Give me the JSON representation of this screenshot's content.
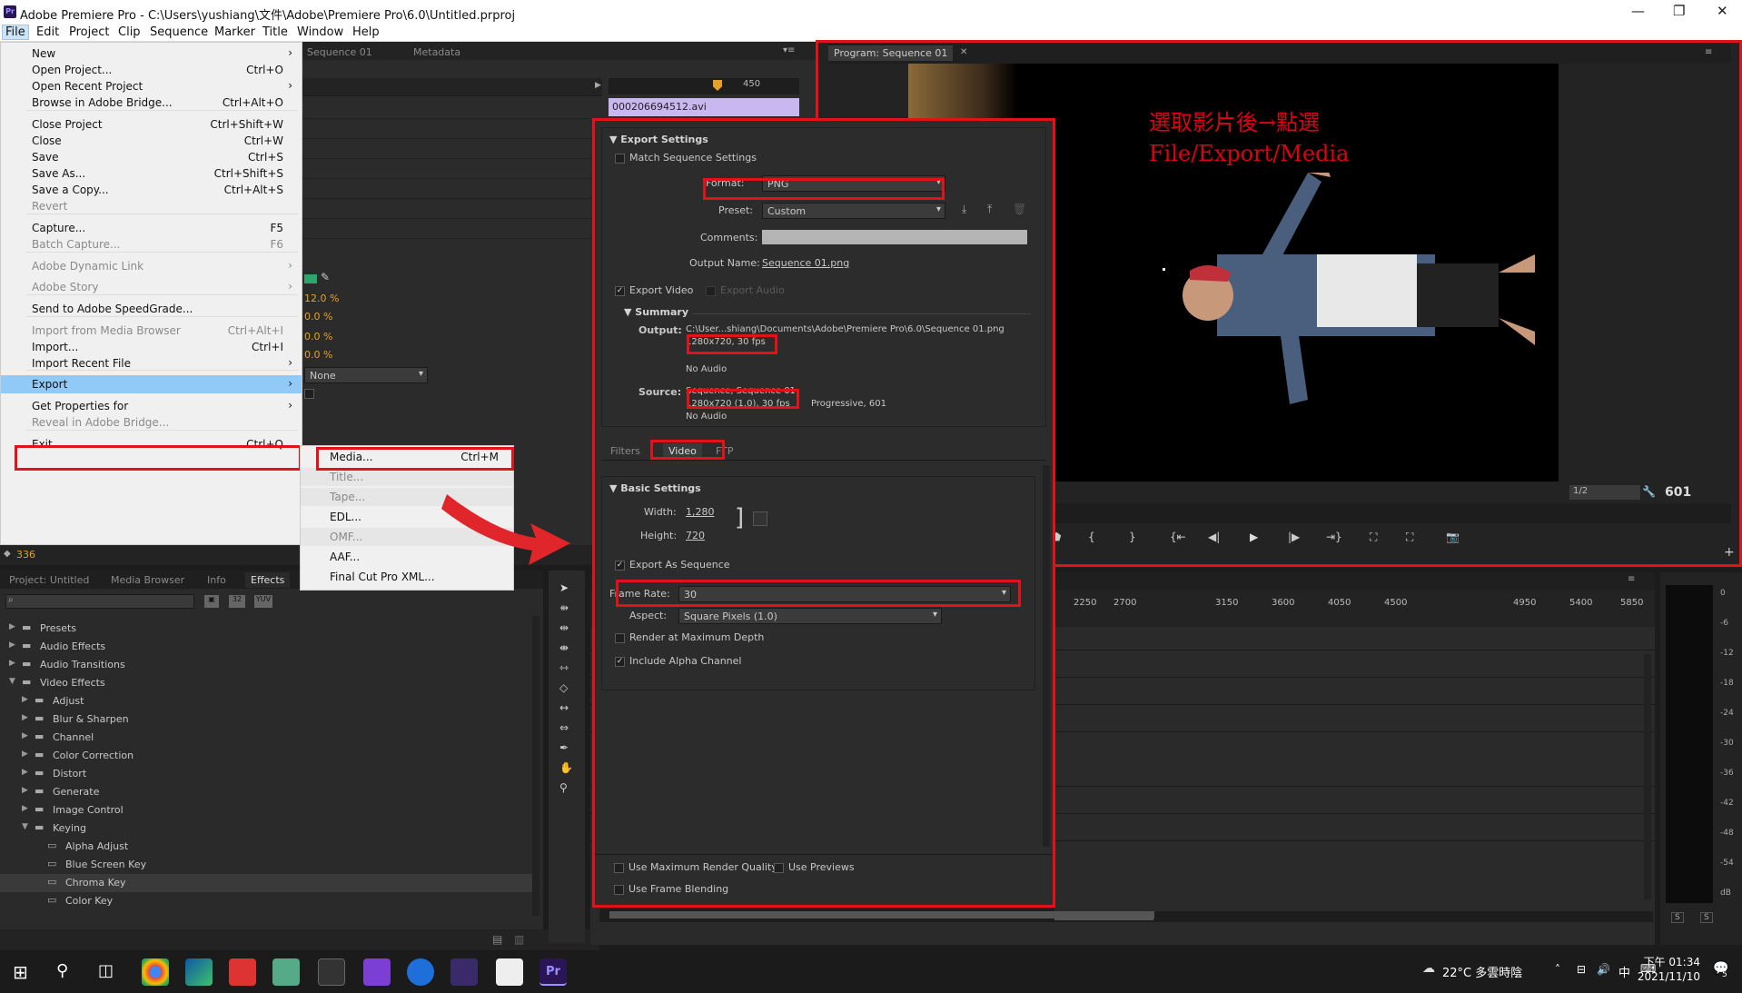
{
  "window": {
    "title": "Adobe Premiere Pro - C:\\Users\\yushiang\\文件\\Adobe\\Premiere Pro\\6.0\\Untitled.prproj",
    "app_icon": "Pr",
    "controls": [
      "—",
      "❐",
      "✕"
    ]
  },
  "menubar": [
    "File",
    "Edit",
    "Project",
    "Clip",
    "Sequence",
    "Marker",
    "Title",
    "Window",
    "Help"
  ],
  "file_menu": [
    {
      "label": "New",
      "shortcut": "",
      "arrow": true
    },
    {
      "label": "Open Project...",
      "shortcut": "Ctrl+O"
    },
    {
      "label": "Open Recent Project",
      "shortcut": "",
      "arrow": true
    },
    {
      "label": "Browse in Adobe Bridge...",
      "shortcut": "Ctrl+Alt+O"
    },
    {
      "label": "Close Project",
      "shortcut": "Ctrl+Shift+W"
    },
    {
      "label": "Close",
      "shortcut": "Ctrl+W"
    },
    {
      "label": "Save",
      "shortcut": "Ctrl+S"
    },
    {
      "label": "Save As...",
      "shortcut": "Ctrl+Shift+S"
    },
    {
      "label": "Save a Copy...",
      "shortcut": "Ctrl+Alt+S"
    },
    {
      "label": "Revert",
      "shortcut": "",
      "disabled": true
    },
    {
      "label": "Capture...",
      "shortcut": "F5"
    },
    {
      "label": "Batch Capture...",
      "shortcut": "F6",
      "disabled": true
    },
    {
      "label": "Adobe Dynamic Link",
      "shortcut": "",
      "arrow": true,
      "disabled": true
    },
    {
      "label": "Adobe Story",
      "shortcut": "",
      "arrow": true,
      "disabled": true
    },
    {
      "label": "Send to Adobe SpeedGrade...",
      "shortcut": ""
    },
    {
      "label": "Import from Media Browser",
      "shortcut": "Ctrl+Alt+I",
      "disabled": true
    },
    {
      "label": "Import...",
      "shortcut": "Ctrl+I"
    },
    {
      "label": "Import Recent File",
      "shortcut": "",
      "arrow": true
    },
    {
      "label": "Export",
      "shortcut": "",
      "arrow": true
    },
    {
      "label": "Get Properties for",
      "shortcut": "",
      "arrow": true
    },
    {
      "label": "Reveal in Adobe Bridge...",
      "shortcut": "",
      "disabled": true
    },
    {
      "label": "Exit",
      "shortcut": "Ctrl+Q"
    }
  ],
  "export_submenu": [
    {
      "label": "Media...",
      "shortcut": "Ctrl+M"
    },
    {
      "label": "Title...",
      "disabled": true
    },
    {
      "label": "Tape...",
      "disabled": true
    },
    {
      "label": "EDL..."
    },
    {
      "label": "OMF...",
      "disabled": true
    },
    {
      "label": "AAF..."
    },
    {
      "label": "Final Cut Pro XML..."
    }
  ],
  "source_tabs": [
    "Sequence 01",
    "Metadata"
  ],
  "timeline_top": {
    "marker": "450",
    "clip": "000206694512.avi"
  },
  "effect_controls": {
    "values": [
      "12.0 %",
      "0.0 %",
      "0.0 %",
      "0.0 %"
    ],
    "blend": "None",
    "timecode": "336"
  },
  "project_tabs": [
    "Project: Untitled",
    "Media Browser",
    "Info",
    "Effects"
  ],
  "effects_tree": [
    {
      "label": "Presets",
      "depth": 0,
      "open": false
    },
    {
      "label": "Audio Effects",
      "depth": 0,
      "open": false
    },
    {
      "label": "Audio Transitions",
      "depth": 0,
      "open": false
    },
    {
      "label": "Video Effects",
      "depth": 0,
      "open": true
    },
    {
      "label": "Adjust",
      "depth": 1,
      "open": false
    },
    {
      "label": "Blur & Sharpen",
      "depth": 1,
      "open": false
    },
    {
      "label": "Channel",
      "depth": 1,
      "open": false
    },
    {
      "label": "Color Correction",
      "depth": 1,
      "open": false
    },
    {
      "label": "Distort",
      "depth": 1,
      "open": false
    },
    {
      "label": "Generate",
      "depth": 1,
      "open": false
    },
    {
      "label": "Image Control",
      "depth": 1,
      "open": false
    },
    {
      "label": "Keying",
      "depth": 1,
      "open": true
    },
    {
      "label": "Alpha Adjust",
      "depth": 2,
      "leaf": true
    },
    {
      "label": "Blue Screen Key",
      "depth": 2,
      "leaf": true
    },
    {
      "label": "Chroma Key",
      "depth": 2,
      "leaf": true,
      "selected": true
    },
    {
      "label": "Color Key",
      "depth": 2,
      "leaf": true
    }
  ],
  "export": {
    "section": "Export Settings",
    "match_seq": "Match Sequence Settings",
    "format_label": "Format:",
    "format": "PNG",
    "preset_label": "Preset:",
    "preset": "Custom",
    "comments_label": "Comments:",
    "output_name_label": "Output Name:",
    "output_name": "Sequence 01.png",
    "export_video": "Export Video",
    "export_audio": "Export Audio",
    "summary": "Summary",
    "output_label": "Output:",
    "output_path": "C:\\User...shiang\\Documents\\Adobe\\Premiere Pro\\6.0\\Sequence 01.png",
    "output_res": "1280x720, 30 fps",
    "output_audio": "No Audio",
    "source_label": "Source:",
    "source_name": "Sequence, Sequence 01",
    "source_res": "1280x720 (1.0), 30 fps",
    "source_extra": "Progressive, 601",
    "source_audio": "No Audio",
    "tabs": [
      "Filters",
      "Video",
      "FTP"
    ],
    "basic": "Basic Settings",
    "width_label": "Width:",
    "width": "1,280",
    "height_label": "Height:",
    "height": "720",
    "export_seq": "Export As Sequence",
    "frame_rate_label": "Frame Rate:",
    "frame_rate": "30",
    "aspect_label": "Aspect:",
    "aspect": "Square Pixels (1.0)",
    "render_max": "Render at Maximum Depth",
    "alpha": "Include Alpha Channel",
    "max_render": "Use Maximum Render Quality",
    "previews": "Use Previews",
    "blending": "Use Frame Blending"
  },
  "program": {
    "tab": "Program: Sequence 01",
    "annotation_line1": "選取影片後→點選",
    "annotation_line2": "File/Export/Media",
    "zoom": "1/2",
    "frame": "601"
  },
  "timeline_ruler": [
    "2250",
    "2700",
    "3150",
    "3600",
    "4050",
    "4500",
    "4950",
    "5400",
    "5850"
  ],
  "meter": [
    "0",
    "-6",
    "-12",
    "-18",
    "-24",
    "-30",
    "-36",
    "-42",
    "-48",
    "-54",
    "dB"
  ],
  "meter_buttons": [
    "S",
    "S"
  ],
  "tray": {
    "weather": "22°C 多雲時陰",
    "ime": "中",
    "time": "下午 01:34",
    "date": "2021/11/10",
    "notif": "5"
  }
}
